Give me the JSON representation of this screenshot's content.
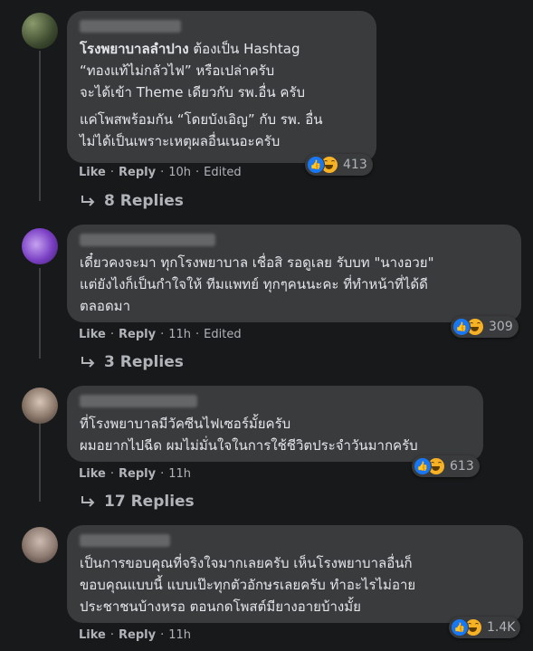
{
  "comments": [
    {
      "paragraphs": [
        [
          {
            "text": "โรงพยาบาลลำปาง",
            "bold": true
          },
          {
            "text": " ต้องเป็น Hashtag\n“ทองแท้ไม่กลัวไฟ” หรือเปล่าครับ\nจะได้เข้า Theme เดียวกับ รพ.อื่น ครับ",
            "bold": false
          }
        ],
        [
          {
            "text": "แค่โพสพร้อมกัน “โดยบังเอิญ” กับ รพ. อื่น\nไม่ได้เป็นเพราะเหตุผลอื่นเนอะครับ",
            "bold": false
          }
        ]
      ],
      "like_label": "Like",
      "reply_label": "Reply",
      "time": "10h",
      "edited": "Edited",
      "reaction_count": "413",
      "replies_label": "8 Replies"
    },
    {
      "paragraphs": [
        [
          {
            "text": "เดี๋ยวคงจะมา ทุกโรงพยาบาล เชื่อสิ รอดูเลย รับบท \"นางอวย\"\nแต่ยังไงก็เป็นกำใจให้ ทีมแพทย์ ทุกๆคนนะคะ ที่ทำหน้าที่ได้ดี\nตลอดมา",
            "bold": false
          }
        ]
      ],
      "like_label": "Like",
      "reply_label": "Reply",
      "time": "11h",
      "edited": "Edited",
      "reaction_count": "309",
      "replies_label": "3 Replies"
    },
    {
      "paragraphs": [
        [
          {
            "text": "ที่โรงพยาบาลมีวัคซีนไฟเซอร์มั้ยครับ\nผมอยากไปฉีด ผมไม่มั่นใจในการใช้ชีวิตประจำวันมากครับ",
            "bold": false
          }
        ]
      ],
      "like_label": "Like",
      "reply_label": "Reply",
      "time": "11h",
      "edited": "",
      "reaction_count": "613",
      "replies_label": "17 Replies"
    },
    {
      "paragraphs": [
        [
          {
            "text": "เป็นการขอบคุณที่จริงใจมากเลยครับ เห็นโรงพยาบาลอื่นก็\nขอบคุณแบบนี้ แบบเป๊ะทุกตัวอักษรเลยครับ ทำอะไรไม่อาย\nประชาชนบ้างหรอ ตอนกดโพสต์มียางอายบ้างมั้ย",
            "bold": false
          }
        ]
      ],
      "like_label": "Like",
      "reply_label": "Reply",
      "time": "11h",
      "edited": "",
      "reaction_count": "1.4K",
      "replies_label": ""
    }
  ],
  "colors": {
    "background": "#18191a",
    "bubble": "#3a3b3c",
    "text": "#e4e6eb",
    "secondary_text": "#b0b3b8",
    "like_blue": "#1877f2",
    "haha_yellow": "#f7b125"
  },
  "icons": {
    "like": "thumbs-up-icon",
    "haha": "laughing-face-icon",
    "reply_arrow": "reply-arrow-icon"
  }
}
